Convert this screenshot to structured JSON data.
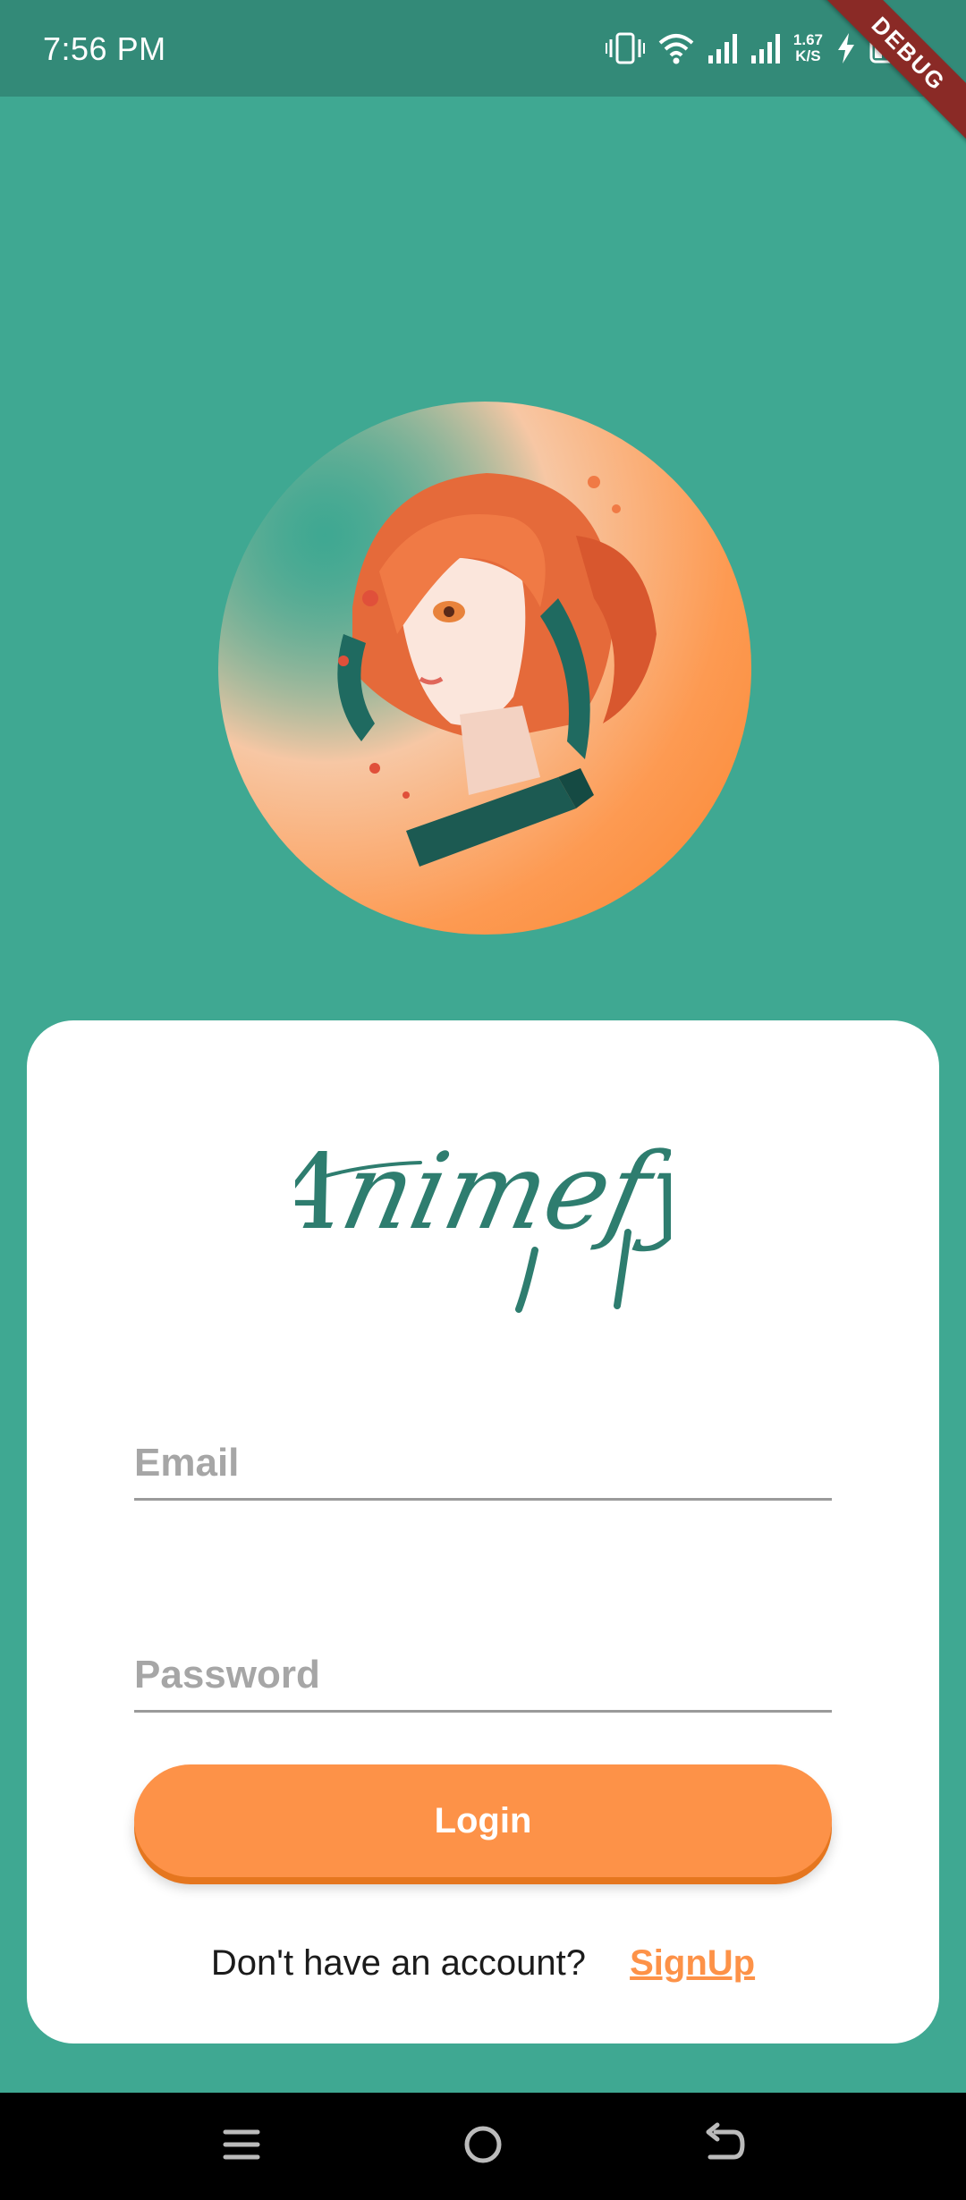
{
  "status_bar": {
    "time": "7:56 PM",
    "net_speed_value": "1.67",
    "net_speed_unit": "K/S",
    "battery": "15",
    "debug_label": "DEBUG"
  },
  "brand": {
    "logo_text": "Animefy"
  },
  "form": {
    "email_placeholder": "Email",
    "password_placeholder": "Password",
    "login_label": "Login"
  },
  "signup": {
    "prompt": "Don't have an account?",
    "link_label": "SignUp"
  },
  "colors": {
    "background": "#3fa892",
    "status_bar": "#338a78",
    "accent": "#fd9248",
    "brand_text": "#2e7d6f"
  },
  "icons": {
    "status": [
      "vibrate-icon",
      "wifi-icon",
      "signal-icon",
      "signal-icon",
      "charging-icon",
      "battery-icon"
    ],
    "nav": [
      "menu-icon",
      "home-icon",
      "back-icon"
    ]
  }
}
